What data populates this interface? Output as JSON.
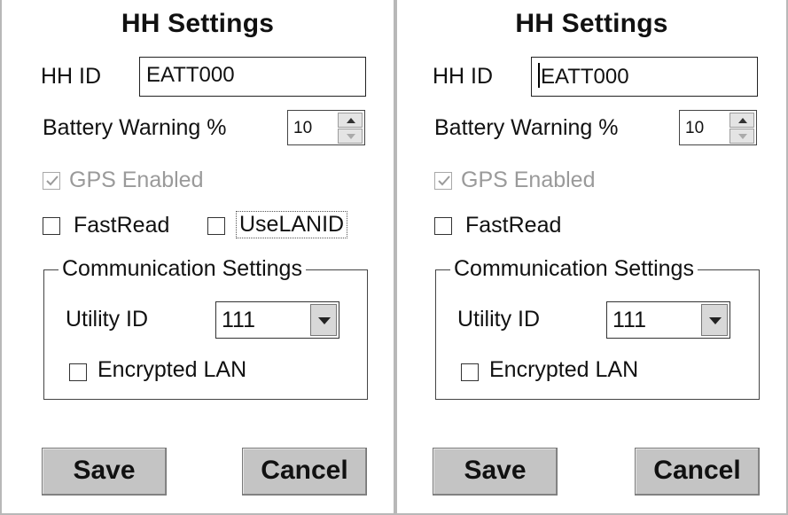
{
  "dialog": {
    "title": "HH Settings",
    "hh_id_label": "HH ID",
    "hh_id_value": "EATT000",
    "battery_label": "Battery Warning %",
    "battery_value": "10",
    "gps_label": "GPS Enabled",
    "gps_checked": true,
    "gps_enabled": false,
    "fastread_label": "FastRead",
    "uselanid_label": "UseLANID",
    "group_title": "Communication Settings",
    "utility_label": "Utility ID",
    "utility_value": "111",
    "encrypted_label": "Encrypted LAN",
    "save_label": "Save",
    "cancel_label": "Cancel"
  },
  "icons": [
    "spin-up-icon",
    "spin-down-icon",
    "dropdown-arrow-icon",
    "checkmark-icon"
  ]
}
